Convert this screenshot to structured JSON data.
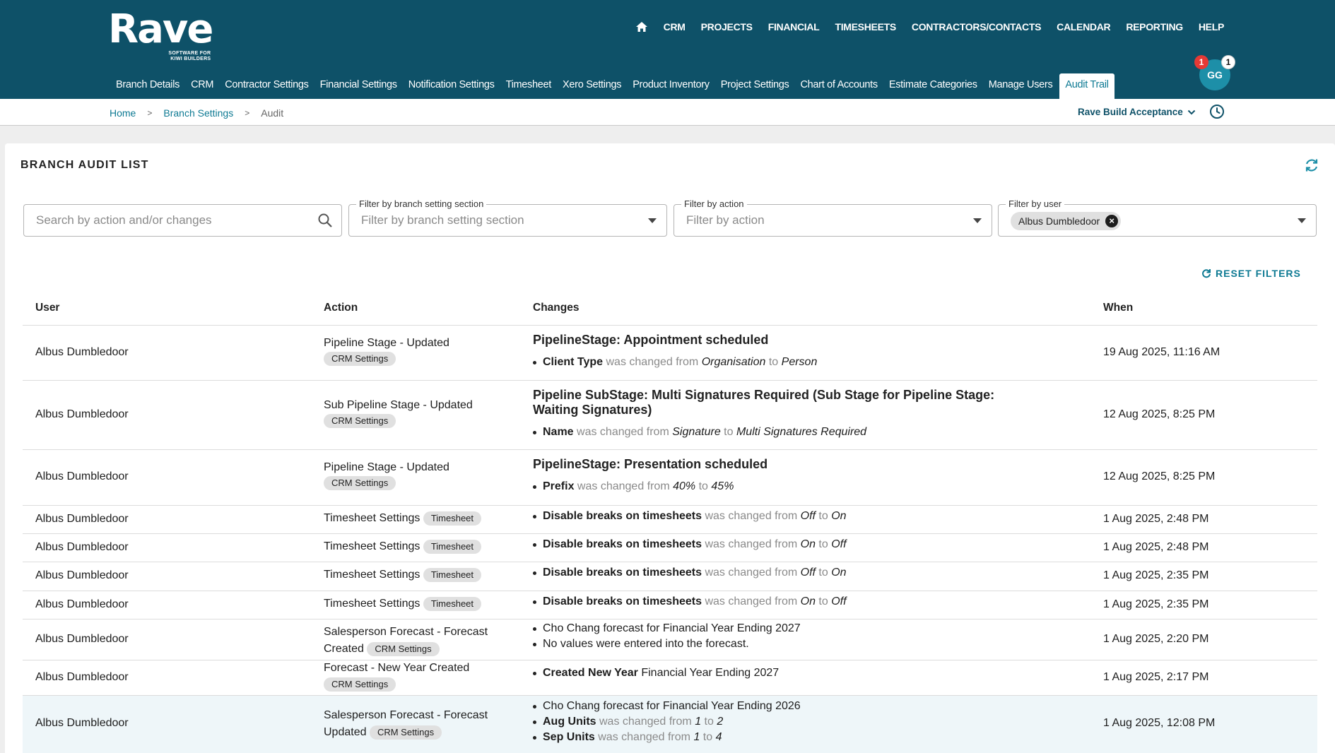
{
  "brand": {
    "name": "Rave",
    "tagline_1": "SOFTWARE FOR",
    "tagline_2": "KIWI BUILDERS"
  },
  "main_nav": [
    "CRM",
    "PROJECTS",
    "FINANCIAL",
    "TIMESHEETS",
    "CONTRACTORS/CONTACTS",
    "CALENDAR",
    "REPORTING",
    "HELP"
  ],
  "sub_nav": [
    "Branch Details",
    "CRM",
    "Contractor Settings",
    "Financial Settings",
    "Notification Settings",
    "Timesheet",
    "Xero Settings",
    "Product Inventory",
    "Project Settings",
    "Chart of Accounts",
    "Estimate Categories",
    "Manage Users",
    "Audit Trail"
  ],
  "user": {
    "initials": "GG",
    "badge_red": "1",
    "badge_white": "1"
  },
  "breadcrumb": {
    "home": "Home",
    "branch_settings": "Branch Settings",
    "current": "Audit"
  },
  "org": "Rave Build Acceptance",
  "page_title": "BRANCH AUDIT LIST",
  "filters": {
    "search_placeholder": "Search by action and/or changes",
    "section_label": "Filter by branch setting section",
    "section_placeholder": "Filter by branch setting section",
    "action_label": "Filter by action",
    "action_placeholder": "Filter by action",
    "user_label": "Filter by user",
    "user_chip": "Albus Dumbledoor"
  },
  "reset_label": "RESET FILTERS",
  "columns": {
    "user": "User",
    "action": "Action",
    "changes": "Changes",
    "when": "When"
  },
  "rows": [
    {
      "user": "Albus Dumbledoor",
      "action": "Pipeline Stage - Updated",
      "tag": "CRM Settings",
      "title": "PipelineStage: Appointment scheduled",
      "field": "Client Type",
      "mid": "was changed from",
      "from": "Organisation",
      "to_word": "to",
      "to": "Person",
      "when": "19 Aug 2025, 11:16 AM"
    },
    {
      "user": "Albus Dumbledoor",
      "action": "Sub Pipeline Stage - Updated",
      "tag": "CRM Settings",
      "title": "Pipeline SubStage: Multi Signatures Required (Sub Stage for Pipeline Stage: Waiting Signatures)",
      "field": "Name",
      "mid": "was changed from",
      "from": "Signature",
      "to_word": "to",
      "to": "Multi Signatures Required",
      "when": "12 Aug 2025, 8:25 PM"
    },
    {
      "user": "Albus Dumbledoor",
      "action": "Pipeline Stage - Updated",
      "tag": "CRM Settings",
      "title": "PipelineStage: Presentation scheduled",
      "field": "Prefix",
      "mid": "was changed from",
      "from": "40%",
      "to_word": "to",
      "to": "45%",
      "when": "12 Aug 2025, 8:25 PM"
    },
    {
      "user": "Albus Dumbledoor",
      "action": "Timesheet Settings",
      "tag": "Timesheet",
      "field": "Disable breaks on timesheets",
      "mid": "was changed from",
      "from": "Off",
      "to_word": "to",
      "to": "On",
      "when": "1 Aug 2025, 2:48 PM"
    },
    {
      "user": "Albus Dumbledoor",
      "action": "Timesheet Settings",
      "tag": "Timesheet",
      "field": "Disable breaks on timesheets",
      "mid": "was changed from",
      "from": "On",
      "to_word": "to",
      "to": "Off",
      "when": "1 Aug 2025, 2:48 PM"
    },
    {
      "user": "Albus Dumbledoor",
      "action": "Timesheet Settings",
      "tag": "Timesheet",
      "field": "Disable breaks on timesheets",
      "mid": "was changed from",
      "from": "Off",
      "to_word": "to",
      "to": "On",
      "when": "1 Aug 2025, 2:35 PM"
    },
    {
      "user": "Albus Dumbledoor",
      "action": "Timesheet Settings",
      "tag": "Timesheet",
      "field": "Disable breaks on timesheets",
      "mid": "was changed from",
      "from": "On",
      "to_word": "to",
      "to": "Off",
      "when": "1 Aug 2025, 2:35 PM"
    },
    {
      "user": "Albus Dumbledoor",
      "action_1": "Salesperson Forecast - Forecast",
      "action_2": "Created",
      "tag": "CRM Settings",
      "line_1": "Cho Chang forecast for Financial Year Ending 2027",
      "line_2": "No values were entered into the forecast.",
      "when": "1 Aug 2025, 2:20 PM"
    },
    {
      "user": "Albus Dumbledoor",
      "action": "Forecast - New Year Created",
      "tag": "CRM Settings",
      "field": "Created New Year",
      "rest": "Financial Year Ending 2027",
      "when": "1 Aug 2025, 2:17 PM"
    },
    {
      "user": "Albus Dumbledoor",
      "action_1": "Salesperson Forecast - Forecast",
      "action_2": "Updated",
      "tag": "CRM Settings",
      "line_1": "Cho Chang forecast for Financial Year Ending 2026",
      "aug_field": "Aug Units",
      "aug_mid": "was changed from",
      "aug_from": "1",
      "aug_to_word": "to",
      "aug_to": "2",
      "sep_field": "Sep Units",
      "sep_mid": "was changed from",
      "sep_from": "1",
      "sep_to_word": "to",
      "sep_to": "4",
      "when": "1 Aug 2025, 12:08 PM"
    }
  ],
  "colors": {
    "header_bg": "#0e5168",
    "accent": "#0e7a93",
    "badge_red": "#e53935"
  },
  "icons": [
    "home-icon",
    "search-icon",
    "chevron-down-icon",
    "clock-icon",
    "refresh-icon",
    "close-icon",
    "reset-icon"
  ]
}
